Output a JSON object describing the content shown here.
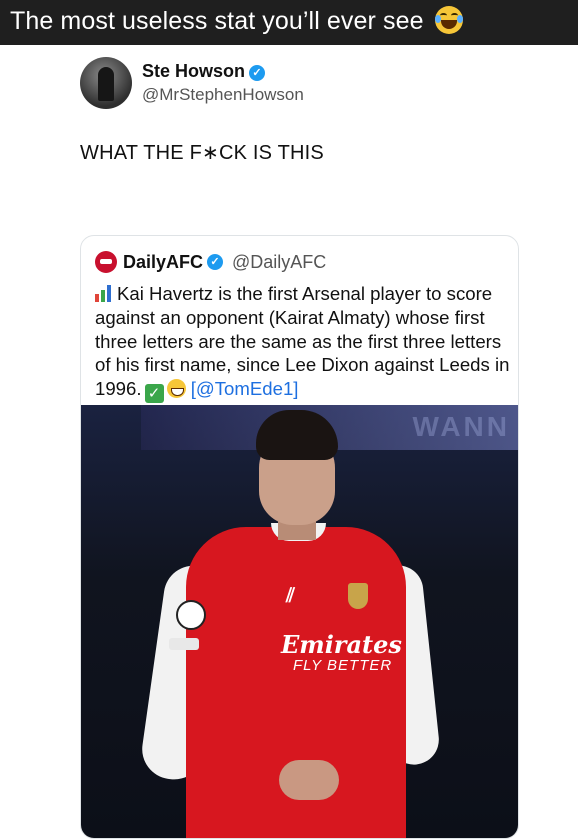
{
  "topbar": {
    "title": "The most useless stat you’ll ever see",
    "emoji": "face-with-tears-of-joy-icon"
  },
  "tweet": {
    "author_name": "Ste Howson",
    "author_handle": "@MrStephenHowson",
    "verified": true,
    "text": "WHAT THE F∗CK IS THIS"
  },
  "quote": {
    "author_name": "DailyAFC",
    "author_handle": "@DailyAFC",
    "verified": true,
    "lines": [
      "Kai Havertz is the first Arsenal player to score",
      "against an opponent (Kairat Almaty) whose first",
      "three letters are the same as the first three letters",
      "of his first name, since Lee Dixon against Leeds in"
    ],
    "last_line_text": "1996.",
    "credit": "[@TomEde1]",
    "image": {
      "banner_text": "WANN",
      "sponsor": "Emirates",
      "sponsor_tagline": "FLY BETTER"
    }
  },
  "colors": {
    "topbar_bg": "#1f1f1f",
    "verified": "#1d9bf0",
    "link": "#1d6fe0",
    "arsenal_red": "#d7171f"
  }
}
